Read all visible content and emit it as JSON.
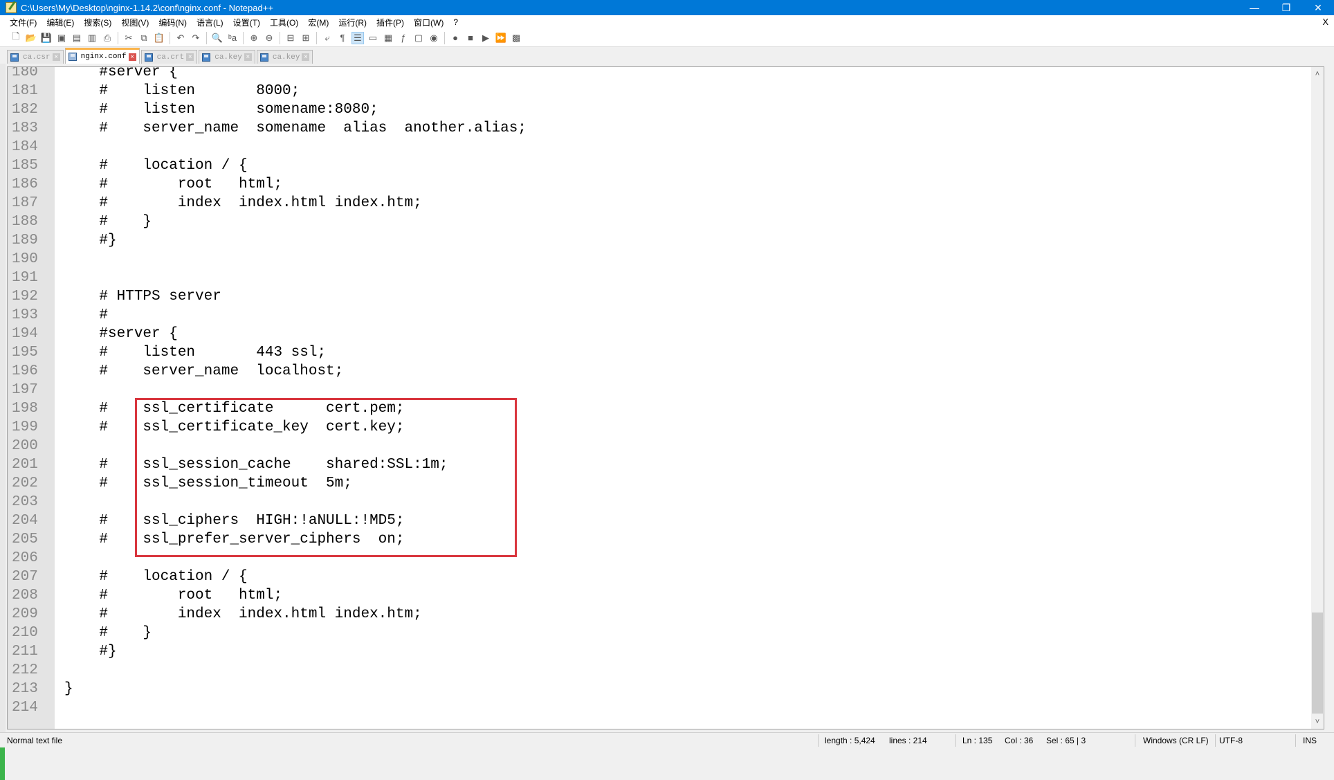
{
  "window": {
    "title": "C:\\Users\\My\\Desktop\\nginx-1.14.2\\conf\\nginx.conf - Notepad++",
    "minimize_label": "—",
    "restore_label": "❐",
    "close_label": "✕"
  },
  "menu": {
    "items": [
      "文件(F)",
      "编辑(E)",
      "搜索(S)",
      "视图(V)",
      "编码(N)",
      "语言(L)",
      "设置(T)",
      "工具(O)",
      "宏(M)",
      "运行(R)",
      "插件(P)",
      "窗口(W)",
      "?"
    ],
    "close_doc_label": "X"
  },
  "toolbar": {
    "buttons": [
      {
        "name": "new-file-icon",
        "glyph": "🗋"
      },
      {
        "name": "open-file-icon",
        "glyph": "📂"
      },
      {
        "name": "save-icon",
        "glyph": "💾"
      },
      {
        "name": "save-all-icon",
        "glyph": "▣"
      },
      {
        "name": "close-icon",
        "glyph": "▤"
      },
      {
        "name": "close-all-icon",
        "glyph": "▥"
      },
      {
        "name": "print-icon",
        "glyph": "⎙"
      },
      {
        "sep": true
      },
      {
        "name": "cut-icon",
        "glyph": "✂"
      },
      {
        "name": "copy-icon",
        "glyph": "⧉"
      },
      {
        "name": "paste-icon",
        "glyph": "📋"
      },
      {
        "sep": true
      },
      {
        "name": "undo-icon",
        "glyph": "↶"
      },
      {
        "name": "redo-icon",
        "glyph": "↷"
      },
      {
        "sep": true
      },
      {
        "name": "find-icon",
        "glyph": "🔍"
      },
      {
        "name": "replace-icon",
        "glyph": "ᵇa"
      },
      {
        "sep": true
      },
      {
        "name": "zoom-in-icon",
        "glyph": "⊕"
      },
      {
        "name": "zoom-out-icon",
        "glyph": "⊖"
      },
      {
        "sep": true
      },
      {
        "name": "sync-vertical-icon",
        "glyph": "⊟"
      },
      {
        "name": "sync-horizontal-icon",
        "glyph": "⊞"
      },
      {
        "sep": true
      },
      {
        "name": "word-wrap-icon",
        "glyph": "⤶"
      },
      {
        "name": "show-all-chars-icon",
        "glyph": "¶"
      },
      {
        "name": "indent-guide-icon",
        "glyph": "☰",
        "active": true
      },
      {
        "name": "user-defined-language-icon",
        "glyph": "▭"
      },
      {
        "name": "document-map-icon",
        "glyph": "▦"
      },
      {
        "name": "function-list-icon",
        "glyph": "ƒ"
      },
      {
        "name": "folder-as-workspace-icon",
        "glyph": "▢"
      },
      {
        "name": "monitoring-icon",
        "glyph": "◉"
      },
      {
        "sep": true
      },
      {
        "name": "record-macro-icon",
        "glyph": "●"
      },
      {
        "name": "stop-recording-icon",
        "glyph": "■"
      },
      {
        "name": "playback-macro-icon",
        "glyph": "▶"
      },
      {
        "name": "run-macro-multiple-icon",
        "glyph": "⏩"
      },
      {
        "name": "save-macro-icon",
        "glyph": "▩"
      }
    ]
  },
  "tabs": [
    {
      "label": "ca.csr",
      "active": false
    },
    {
      "label": "nginx.conf",
      "active": true
    },
    {
      "label": "ca.crt",
      "active": false
    },
    {
      "label": "ca.key",
      "active": false
    },
    {
      "label": "ca.key",
      "active": false
    }
  ],
  "editor": {
    "lines": [
      {
        "n": "180",
        "text": "    #server {"
      },
      {
        "n": "181",
        "text": "    #    listen       8000;"
      },
      {
        "n": "182",
        "text": "    #    listen       somename:8080;"
      },
      {
        "n": "183",
        "text": "    #    server_name  somename  alias  another.alias;"
      },
      {
        "n": "184",
        "text": ""
      },
      {
        "n": "185",
        "text": "    #    location / {"
      },
      {
        "n": "186",
        "text": "    #        root   html;"
      },
      {
        "n": "187",
        "text": "    #        index  index.html index.htm;"
      },
      {
        "n": "188",
        "text": "    #    }"
      },
      {
        "n": "189",
        "text": "    #}"
      },
      {
        "n": "190",
        "text": ""
      },
      {
        "n": "191",
        "text": ""
      },
      {
        "n": "192",
        "text": "    # HTTPS server"
      },
      {
        "n": "193",
        "text": "    #"
      },
      {
        "n": "194",
        "text": "    #server {"
      },
      {
        "n": "195",
        "text": "    #    listen       443 ssl;"
      },
      {
        "n": "196",
        "text": "    #    server_name  localhost;"
      },
      {
        "n": "197",
        "text": ""
      },
      {
        "n": "198",
        "text": "    #    ssl_certificate      cert.pem;"
      },
      {
        "n": "199",
        "text": "    #    ssl_certificate_key  cert.key;"
      },
      {
        "n": "200",
        "text": ""
      },
      {
        "n": "201",
        "text": "    #    ssl_session_cache    shared:SSL:1m;"
      },
      {
        "n": "202",
        "text": "    #    ssl_session_timeout  5m;"
      },
      {
        "n": "203",
        "text": ""
      },
      {
        "n": "204",
        "text": "    #    ssl_ciphers  HIGH:!aNULL:!MD5;"
      },
      {
        "n": "205",
        "text": "    #    ssl_prefer_server_ciphers  on;"
      },
      {
        "n": "206",
        "text": ""
      },
      {
        "n": "207",
        "text": "    #    location / {"
      },
      {
        "n": "208",
        "text": "    #        root   html;"
      },
      {
        "n": "209",
        "text": "    #        index  index.html index.htm;"
      },
      {
        "n": "210",
        "text": "    #    }"
      },
      {
        "n": "211",
        "text": "    #}"
      },
      {
        "n": "212",
        "text": ""
      },
      {
        "n": "213",
        "text": "}"
      },
      {
        "n": "214",
        "text": ""
      }
    ],
    "highlight_color": "#d9363e",
    "scroll_up_label": "˄",
    "scroll_down_label": "˅"
  },
  "status": {
    "file_type": "Normal text file",
    "length": "length : 5,424",
    "lines": "lines : 214",
    "ln": "Ln : 135",
    "col": "Col : 36",
    "sel": "Sel : 65 | 3",
    "eol": "Windows (CR LF)",
    "encoding": "UTF-8",
    "mode": "INS"
  },
  "colors": {
    "titlebar": "#0078d7",
    "active_tab_accent": "#fab44c"
  }
}
